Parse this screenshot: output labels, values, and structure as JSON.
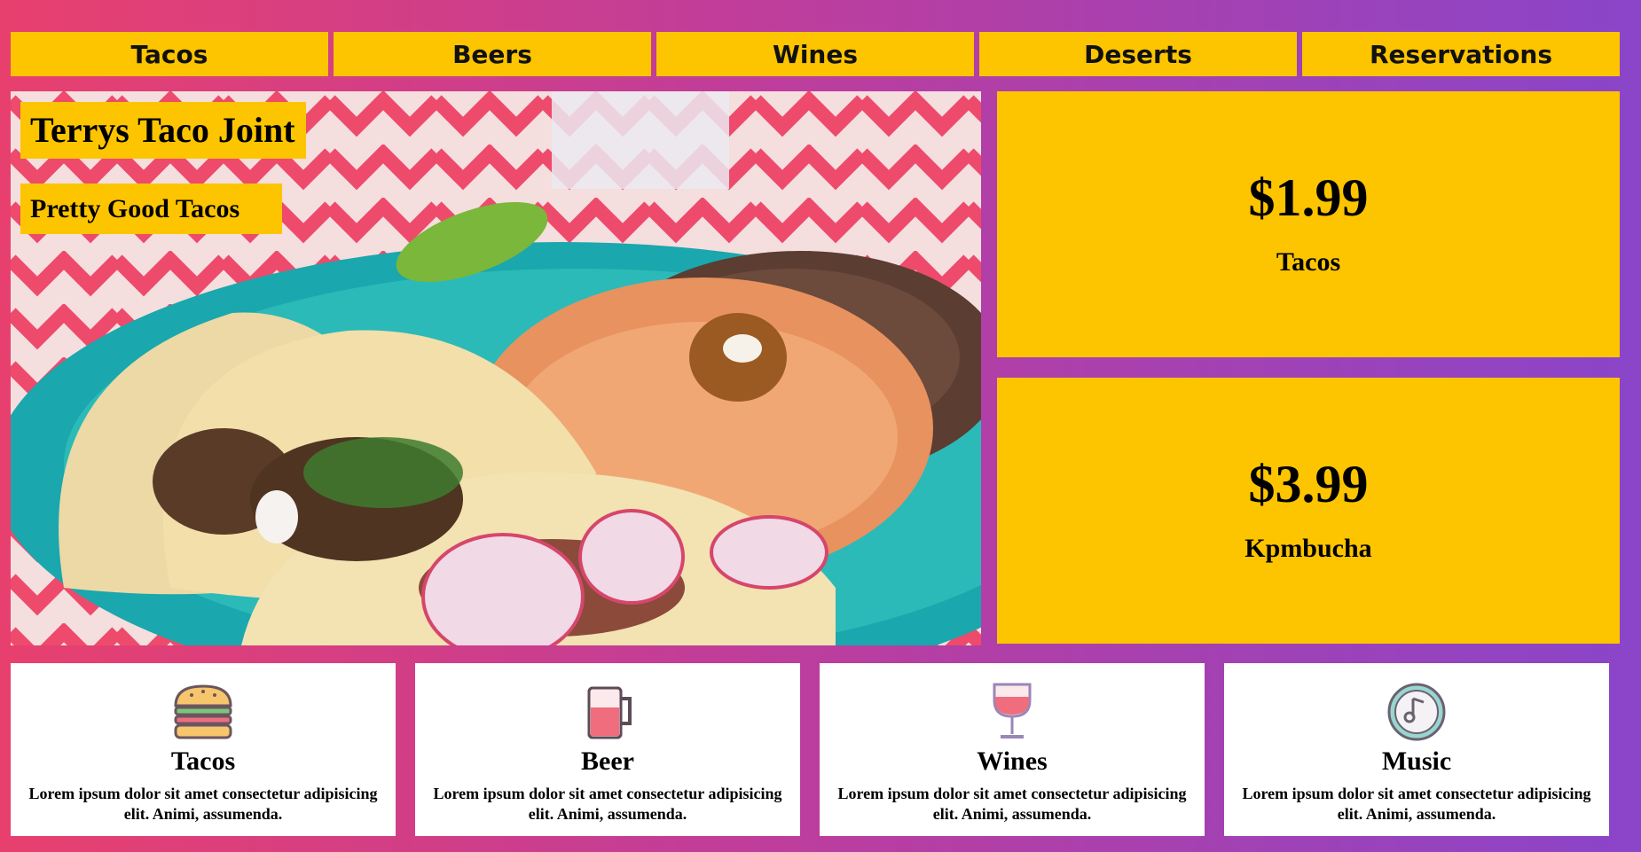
{
  "nav": {
    "items": [
      {
        "label": "Tacos"
      },
      {
        "label": "Beers"
      },
      {
        "label": "Wines"
      },
      {
        "label": "Deserts"
      },
      {
        "label": "Reservations"
      }
    ]
  },
  "hero": {
    "title": "Terrys Taco Joint",
    "subtitle": "Pretty Good Tacos"
  },
  "prices": [
    {
      "price": "$1.99",
      "label": "Tacos"
    },
    {
      "price": "$3.99",
      "label": "Kpmbucha"
    }
  ],
  "cards": [
    {
      "icon": "burger-icon",
      "title": "Tacos",
      "text": "Lorem ipsum dolor sit amet consectetur adipisicing elit. Animi, assumenda."
    },
    {
      "icon": "beer-mug-icon",
      "title": "Beer",
      "text": "Lorem ipsum dolor sit amet consectetur adipisicing elit. Animi, assumenda."
    },
    {
      "icon": "wine-glass-icon",
      "title": "Wines",
      "text": "Lorem ipsum dolor sit amet consectetur adipisicing elit. Animi, assumenda."
    },
    {
      "icon": "music-note-icon",
      "title": "Music",
      "text": "Lorem ipsum dolor sit amet consectetur adipisicing elit. Animi, assumenda."
    }
  ],
  "colors": {
    "accent": "#fdc400",
    "gradient_start": "#e8406e",
    "gradient_end": "#8a45c9"
  }
}
